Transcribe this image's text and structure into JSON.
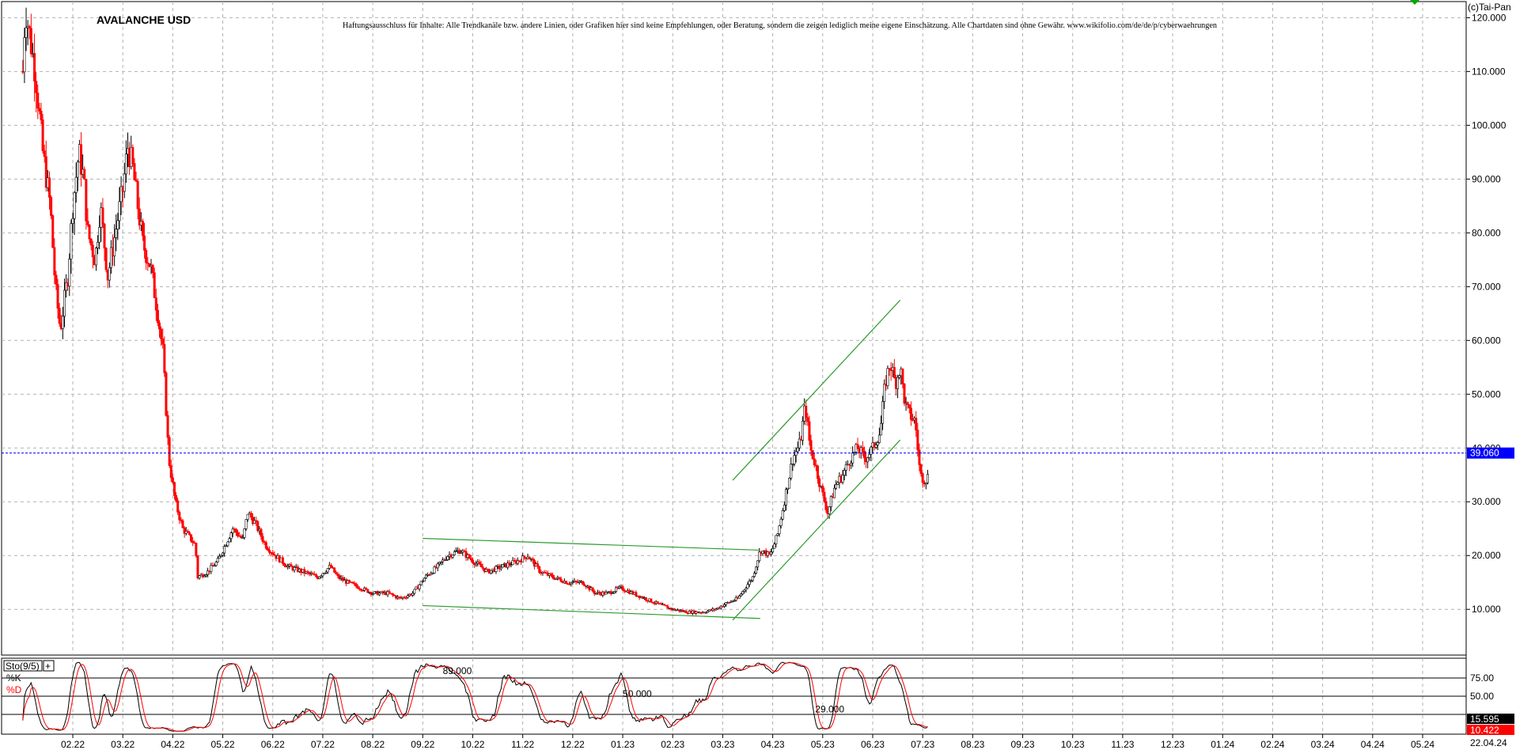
{
  "chart_data": {
    "type": "candlestick",
    "title": "AVALANCHE USD",
    "disclaimer": "Haftungsausschluss für Inhalte: Alle Trendkanäle bzw. andere Linien, oder Grafiken hier sind keine Empfehlungen, oder Beratung, sondern die zeigen lediglich meine eigene Einschätzung. Alle Chartdaten sind ohne Gewähr.  www.wikifolio.com/de/de/p/cyberwaehrungen",
    "copyright": "(c)Tai-Pan",
    "y_ticks": [
      "120.000",
      "110.000",
      "100.000",
      "90.000",
      "80.000",
      "70.000",
      "60.000",
      "50.000",
      "40.000",
      "30.000",
      "20.000",
      "10.000"
    ],
    "y_tick_values": [
      120,
      110,
      100,
      90,
      80,
      70,
      60,
      50,
      40,
      30,
      20,
      10
    ],
    "ylim": [
      1.5,
      123
    ],
    "x_ticks": [
      "02.22",
      "03.22",
      "04.22",
      "05.22",
      "06.22",
      "07.22",
      "08.22",
      "09.22",
      "10.22",
      "11.22",
      "12.22",
      "01.23",
      "02.23",
      "03.23",
      "04.23",
      "05.23",
      "06.23",
      "07.23",
      "08.23",
      "09.23",
      "10.23",
      "11.23",
      "12.23",
      "01.24",
      "02.24",
      "03.24",
      "04.24",
      "05.24"
    ],
    "x_tick_months": [
      1,
      2,
      3,
      4,
      5,
      6,
      7,
      8,
      9,
      10,
      11,
      12,
      13,
      14,
      15,
      16,
      17,
      18,
      19,
      20,
      21,
      22,
      23,
      24,
      25,
      26,
      27,
      28
    ],
    "last_date": "22.04.24",
    "current_price_label": "39.060",
    "current_price": 39.06,
    "price_series": [
      {
        "t": 0,
        "v": 110
      },
      {
        "t": 0.05,
        "v": 122
      },
      {
        "t": 0.25,
        "v": 110
      },
      {
        "t": 0.4,
        "v": 95
      },
      {
        "t": 0.55,
        "v": 85
      },
      {
        "t": 0.65,
        "v": 70
      },
      {
        "t": 0.75,
        "v": 62
      },
      {
        "t": 0.9,
        "v": 72
      },
      {
        "t": 1.0,
        "v": 85
      },
      {
        "t": 1.12,
        "v": 95
      },
      {
        "t": 1.22,
        "v": 90
      },
      {
        "t": 1.3,
        "v": 80
      },
      {
        "t": 1.45,
        "v": 75
      },
      {
        "t": 1.55,
        "v": 85
      },
      {
        "t": 1.7,
        "v": 72
      },
      {
        "t": 1.85,
        "v": 80
      },
      {
        "t": 2.0,
        "v": 88
      },
      {
        "t": 2.1,
        "v": 96
      },
      {
        "t": 2.2,
        "v": 92
      },
      {
        "t": 2.3,
        "v": 85
      },
      {
        "t": 2.4,
        "v": 78
      },
      {
        "t": 2.55,
        "v": 74
      },
      {
        "t": 2.7,
        "v": 65
      },
      {
        "t": 2.8,
        "v": 58
      },
      {
        "t": 2.85,
        "v": 50
      },
      {
        "t": 2.92,
        "v": 38
      },
      {
        "t": 3.05,
        "v": 30
      },
      {
        "t": 3.2,
        "v": 25
      },
      {
        "t": 3.45,
        "v": 22
      },
      {
        "t": 3.5,
        "v": 16
      },
      {
        "t": 3.7,
        "v": 17
      },
      {
        "t": 3.9,
        "v": 19
      },
      {
        "t": 4.05,
        "v": 22
      },
      {
        "t": 4.2,
        "v": 25
      },
      {
        "t": 4.4,
        "v": 23
      },
      {
        "t": 4.5,
        "v": 28
      },
      {
        "t": 4.65,
        "v": 26
      },
      {
        "t": 4.85,
        "v": 22
      },
      {
        "t": 5.05,
        "v": 20
      },
      {
        "t": 5.3,
        "v": 18
      },
      {
        "t": 5.6,
        "v": 17
      },
      {
        "t": 5.9,
        "v": 16
      },
      {
        "t": 6.15,
        "v": 18
      },
      {
        "t": 6.3,
        "v": 16
      },
      {
        "t": 6.5,
        "v": 15
      },
      {
        "t": 6.75,
        "v": 14
      },
      {
        "t": 7.0,
        "v": 13
      },
      {
        "t": 7.3,
        "v": 13
      },
      {
        "t": 7.55,
        "v": 12
      },
      {
        "t": 7.8,
        "v": 13
      },
      {
        "t": 8.05,
        "v": 16
      },
      {
        "t": 8.3,
        "v": 18
      },
      {
        "t": 8.5,
        "v": 20
      },
      {
        "t": 8.75,
        "v": 21
      },
      {
        "t": 9.0,
        "v": 19
      },
      {
        "t": 9.3,
        "v": 17
      },
      {
        "t": 9.6,
        "v": 18
      },
      {
        "t": 9.9,
        "v": 19
      },
      {
        "t": 10.1,
        "v": 20
      },
      {
        "t": 10.35,
        "v": 17
      },
      {
        "t": 10.6,
        "v": 16
      },
      {
        "t": 10.9,
        "v": 15
      },
      {
        "t": 11.2,
        "v": 15
      },
      {
        "t": 11.45,
        "v": 13
      },
      {
        "t": 11.7,
        "v": 13
      },
      {
        "t": 11.95,
        "v": 14
      },
      {
        "t": 12.2,
        "v": 13
      },
      {
        "t": 12.45,
        "v": 12
      },
      {
        "t": 12.7,
        "v": 11
      },
      {
        "t": 13.0,
        "v": 10
      },
      {
        "t": 13.3,
        "v": 9.5
      },
      {
        "t": 13.6,
        "v": 9.5
      },
      {
        "t": 13.85,
        "v": 10
      },
      {
        "t": 14.05,
        "v": 11
      },
      {
        "t": 14.3,
        "v": 12
      },
      {
        "t": 14.6,
        "v": 16
      },
      {
        "t": 14.75,
        "v": 21
      },
      {
        "t": 14.95,
        "v": 20
      },
      {
        "t": 15.1,
        "v": 24
      },
      {
        "t": 15.25,
        "v": 31
      },
      {
        "t": 15.4,
        "v": 38
      },
      {
        "t": 15.55,
        "v": 41
      },
      {
        "t": 15.65,
        "v": 48
      },
      {
        "t": 15.75,
        "v": 40
      },
      {
        "t": 15.85,
        "v": 37
      },
      {
        "t": 15.95,
        "v": 33
      },
      {
        "t": 16.1,
        "v": 28
      },
      {
        "t": 16.25,
        "v": 33
      },
      {
        "t": 16.4,
        "v": 35
      },
      {
        "t": 16.55,
        "v": 38
      },
      {
        "t": 16.7,
        "v": 40
      },
      {
        "t": 16.85,
        "v": 38
      },
      {
        "t": 17.0,
        "v": 40
      },
      {
        "t": 17.15,
        "v": 43
      },
      {
        "t": 17.25,
        "v": 52
      },
      {
        "t": 17.35,
        "v": 56
      },
      {
        "t": 17.45,
        "v": 52
      },
      {
        "t": 17.55,
        "v": 55
      },
      {
        "t": 17.65,
        "v": 48
      },
      {
        "t": 17.75,
        "v": 46
      },
      {
        "t": 17.85,
        "v": 45
      },
      {
        "t": 17.95,
        "v": 35
      },
      {
        "t": 18.05,
        "v": 34
      },
      {
        "t": 18.12,
        "v": 35
      }
    ],
    "channel_lines": [
      {
        "x1": 8.0,
        "y1": 23.2,
        "x2": 14.75,
        "y2": 21.0
      },
      {
        "x1": 8.0,
        "y1": 10.7,
        "x2": 14.75,
        "y2": 8.3
      },
      {
        "x1": 14.2,
        "y1": 34.0,
        "x2": 17.55,
        "y2": 67.5
      },
      {
        "x1": 14.2,
        "y1": 8.0,
        "x2": 17.55,
        "y2": 41.5
      }
    ],
    "oscillator": {
      "label": "Sto(9/5)",
      "add_label": "+",
      "legend": [
        {
          "name": "%K",
          "color": "#000000"
        },
        {
          "name": "%D",
          "color": "#ff0000"
        }
      ],
      "levels": [
        75,
        50,
        25
      ],
      "level_labels": [
        "75.00",
        "50.00"
      ],
      "annotations": [
        {
          "text": "89.000",
          "t": 8.4,
          "v": 85
        },
        {
          "text": "50.000",
          "t": 12.0,
          "v": 53
        },
        {
          "text": "29.000",
          "t": 15.85,
          "v": 32
        }
      ],
      "k_label": "15.595",
      "d_label": "10.422",
      "ylim": [
        0,
        100
      ]
    }
  }
}
